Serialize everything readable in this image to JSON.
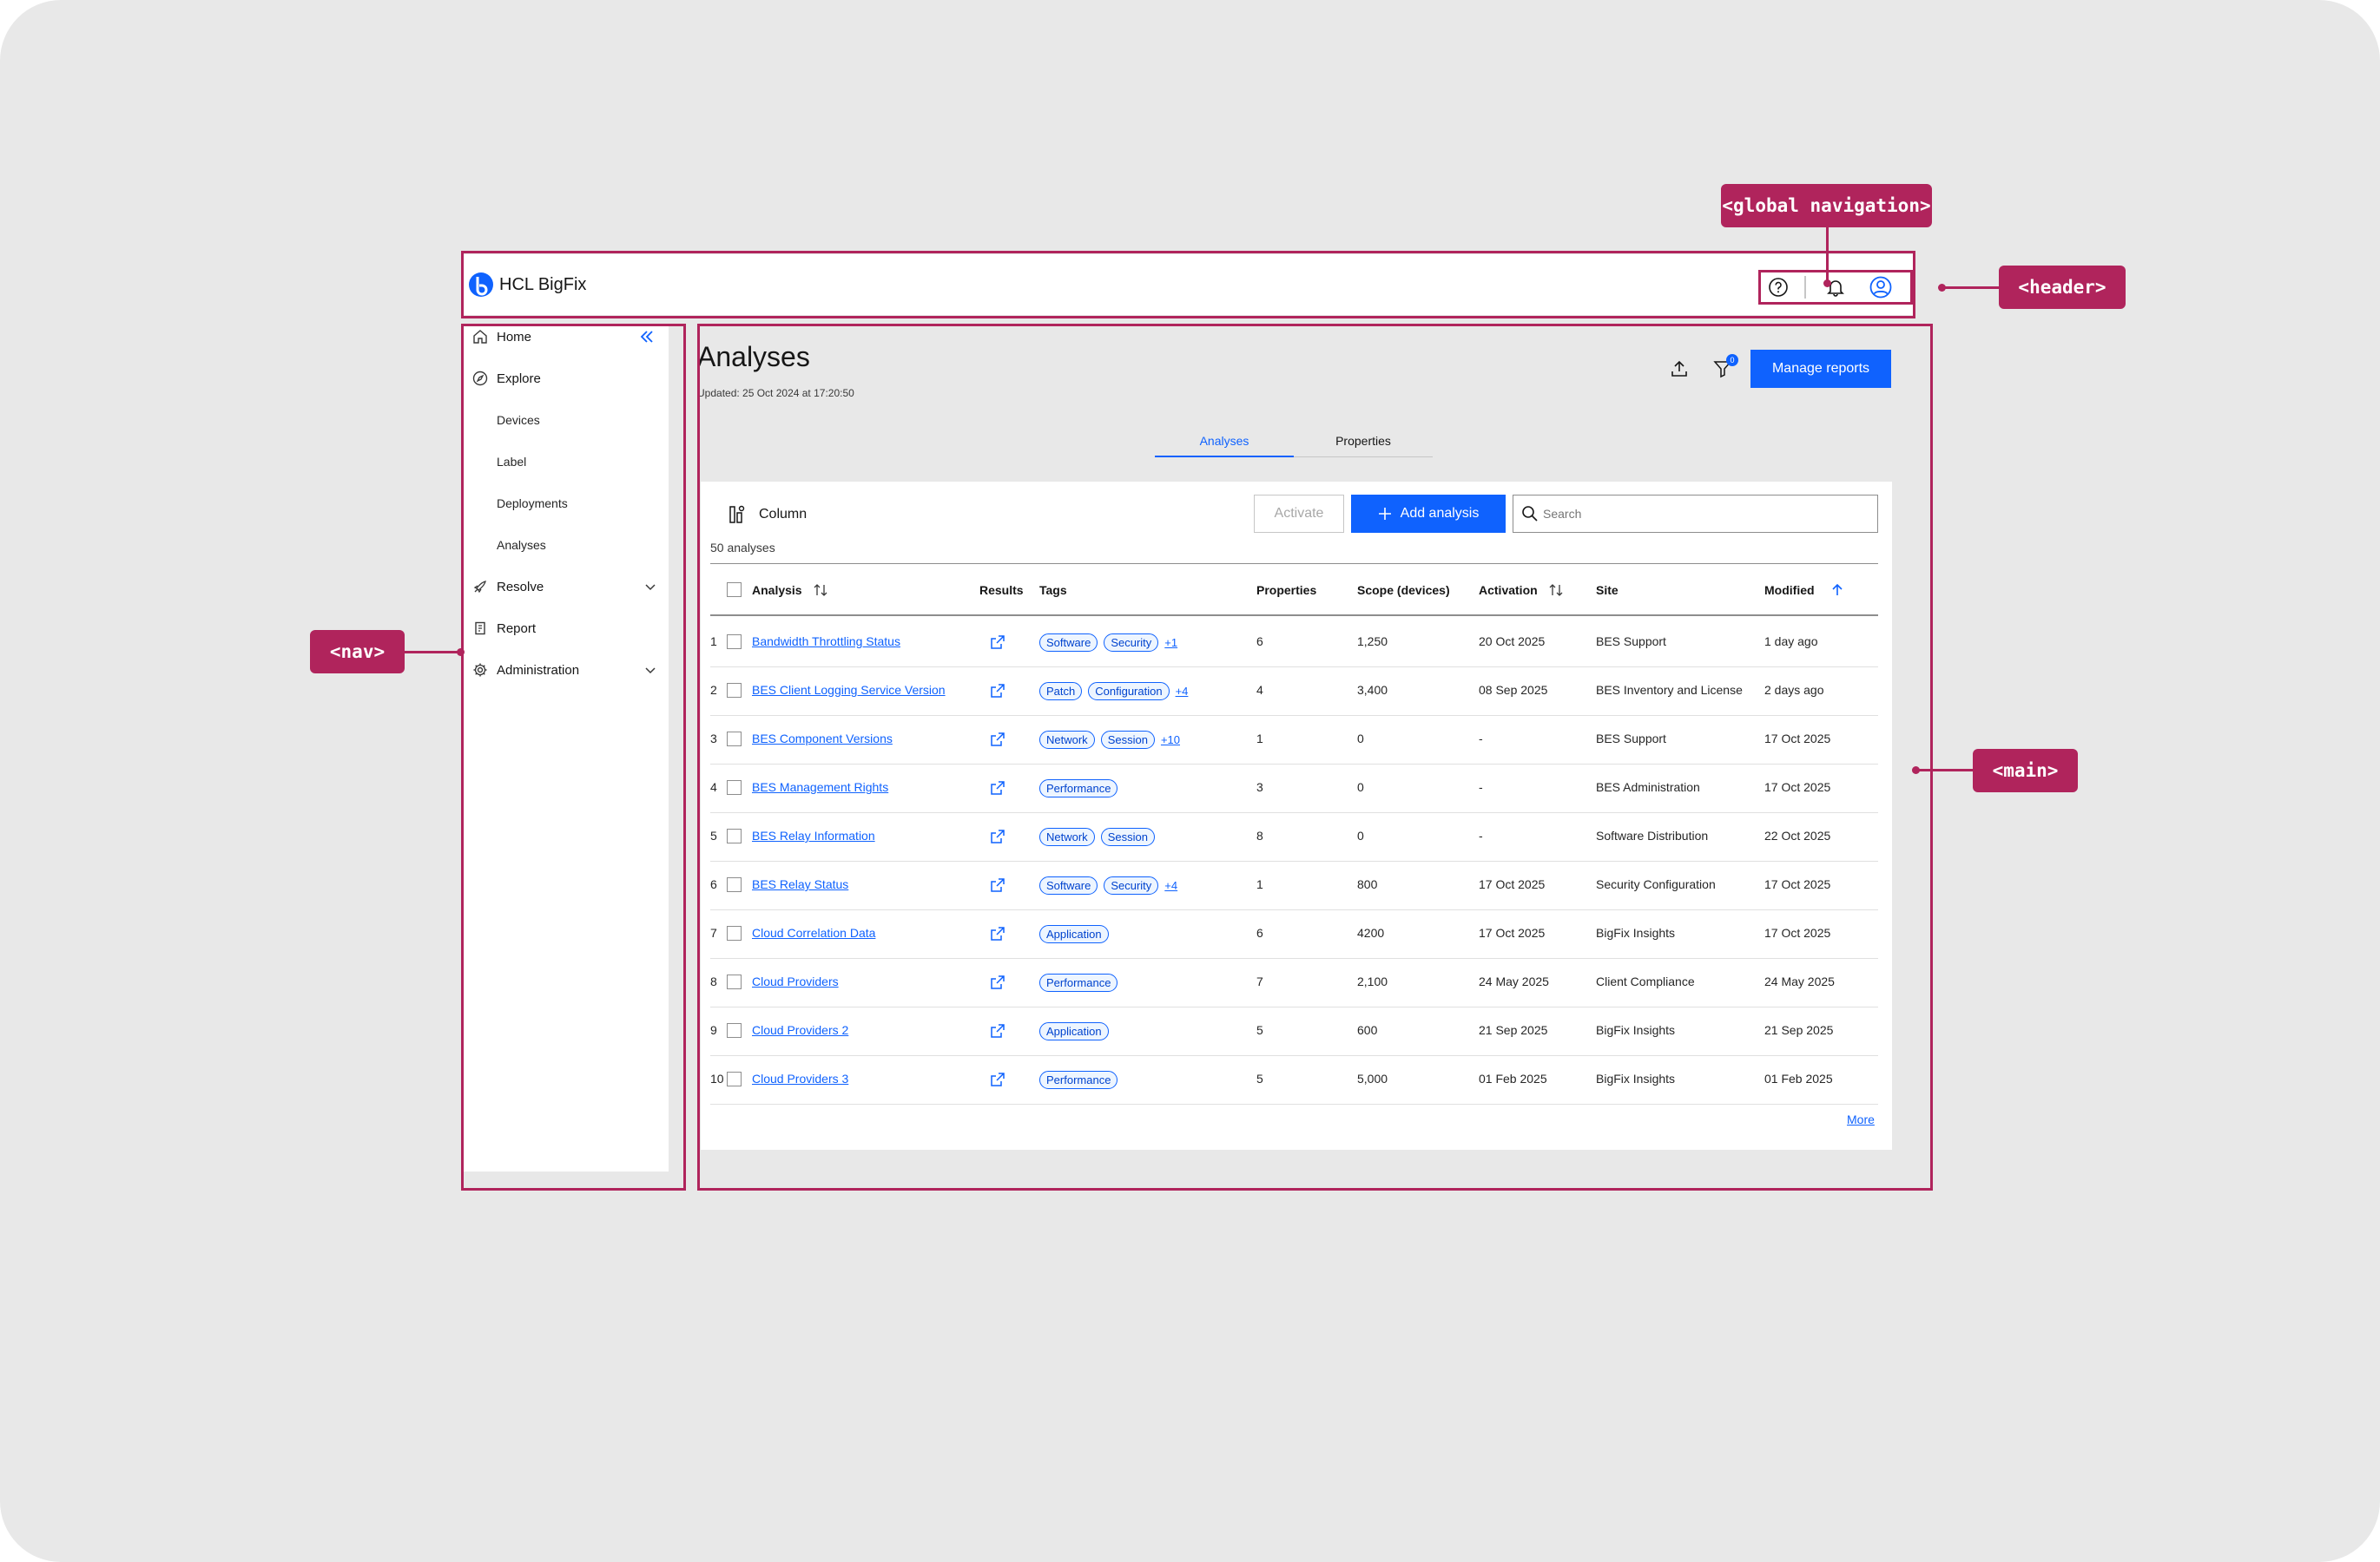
{
  "annotations": {
    "global_navigation": "<global navigation>",
    "header": "<header>",
    "nav": "<nav>",
    "main": "<main>"
  },
  "header": {
    "app_name": "HCL BigFix",
    "icons": [
      "help-icon",
      "notification-icon",
      "user-icon"
    ]
  },
  "nav": {
    "collapse_icon": "double-chevron-left-icon",
    "items": [
      {
        "label": "Home",
        "icon": "home-icon"
      },
      {
        "label": "Explore",
        "icon": "compass-icon"
      },
      {
        "label": "Devices"
      },
      {
        "label": "Label"
      },
      {
        "label": "Deployments"
      },
      {
        "label": "Analyses"
      },
      {
        "label": "Resolve",
        "icon": "rocket-icon"
      },
      {
        "label": "Report",
        "icon": "report-icon"
      },
      {
        "label": "Administration",
        "icon": "gear-icon"
      }
    ]
  },
  "main": {
    "title": "Analyses",
    "updated": "Updated: 25 Oct 2024 at 17:20:50",
    "manage_reports": "Manage reports",
    "filter_badge": "0",
    "tabs": [
      {
        "label": "Analyses",
        "active": true
      },
      {
        "label": "Properties",
        "active": false
      }
    ],
    "toolbar": {
      "column": "Column",
      "activate": "Activate",
      "add_analysis": "Add analysis",
      "search_placeholder": "Search"
    },
    "count": "50 analyses",
    "columns": [
      "Analysis",
      "Results",
      "Tags",
      "Properties",
      "Scope (devices)",
      "Activation",
      "Site",
      "Modified"
    ],
    "rows": [
      {
        "n": "1",
        "name": "Bandwidth Throttling Status",
        "tags": [
          "Software",
          "Security"
        ],
        "more": "+1",
        "properties": "6",
        "scope": "1,250",
        "activation": "20 Oct 2025",
        "site": "BES Support",
        "modified": "1 day ago"
      },
      {
        "n": "2",
        "name": "BES Client Logging Service Version",
        "tags": [
          "Patch",
          "Configuration"
        ],
        "more": "+4",
        "properties": "4",
        "scope": "3,400",
        "activation": "08 Sep 2025",
        "site": "BES Inventory and License",
        "modified": "2 days ago"
      },
      {
        "n": "3",
        "name": "BES Component Versions",
        "tags": [
          "Network",
          "Session"
        ],
        "more": "+10",
        "properties": "1",
        "scope": "0",
        "activation": "-",
        "site": "BES Support",
        "modified": "17 Oct 2025"
      },
      {
        "n": "4",
        "name": "BES Management Rights",
        "tags": [
          "Performance"
        ],
        "more": "",
        "properties": "3",
        "scope": "0",
        "activation": "-",
        "site": "BES Administration",
        "modified": "17 Oct 2025"
      },
      {
        "n": "5",
        "name": "BES Relay Information",
        "tags": [
          "Network",
          "Session"
        ],
        "more": "",
        "properties": "8",
        "scope": "0",
        "activation": "-",
        "site": "Software Distribution",
        "modified": "22 Oct 2025"
      },
      {
        "n": "6",
        "name": "BES Relay Status",
        "tags": [
          "Software",
          "Security"
        ],
        "more": "+4",
        "properties": "1",
        "scope": "800",
        "activation": "17 Oct 2025",
        "site": "Security Configuration",
        "modified": "17 Oct 2025"
      },
      {
        "n": "7",
        "name": "Cloud Correlation Data",
        "tags": [
          "Application"
        ],
        "more": "",
        "properties": "6",
        "scope": "4200",
        "activation": "17 Oct 2025",
        "site": "BigFix Insights",
        "modified": "17 Oct 2025"
      },
      {
        "n": "8",
        "name": "Cloud Providers",
        "tags": [
          "Performance"
        ],
        "more": "",
        "properties": "7",
        "scope": "2,100",
        "activation": "24 May 2025",
        "site": "Client Compliance",
        "modified": "24 May 2025"
      },
      {
        "n": "9",
        "name": "Cloud Providers 2",
        "tags": [
          "Application"
        ],
        "more": "",
        "properties": "5",
        "scope": "600",
        "activation": "21 Sep 2025",
        "site": "BigFix Insights",
        "modified": "21 Sep 2025"
      },
      {
        "n": "10",
        "name": "Cloud Providers 3",
        "tags": [
          "Performance"
        ],
        "more": "",
        "properties": "5",
        "scope": "5,000",
        "activation": "01 Feb 2025",
        "site": "BigFix Insights",
        "modified": "01 Feb 2025"
      }
    ],
    "more": "More"
  },
  "colors": {
    "accent": "#0f62fe",
    "annotation": "#b0245c",
    "background": "#e8e8e8"
  }
}
